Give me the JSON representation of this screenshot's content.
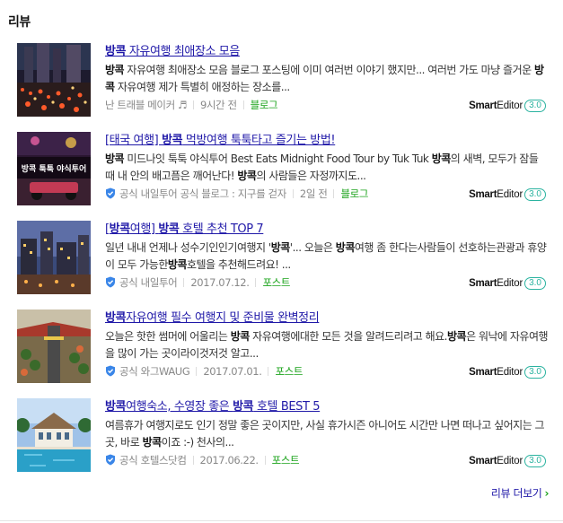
{
  "section": {
    "title": "리뷰"
  },
  "items": [
    {
      "title": [
        {
          "t": "방콕",
          "b": true
        },
        {
          "t": " 자유여행 최애장소 모음",
          "b": false
        }
      ],
      "desc": [
        {
          "t": "방콕",
          "b": true
        },
        {
          "t": " 자유여행 최애장소 모음 블로그 포스팅에 이미 여러번 이야기 했지만... 여러번 가도 마냥 즐거운 ",
          "b": false
        },
        {
          "t": "방콕",
          "b": true
        },
        {
          "t": " 자유여행 제가 특별히 애정하는 장소를...",
          "b": false
        }
      ],
      "official": false,
      "source": "난 트래블 메이커 ♬",
      "date": "9시간 전",
      "type": "블로그",
      "editor": [
        "Smart",
        "Editor",
        "3.0"
      ],
      "thumb": "city-traffic"
    },
    {
      "title": [
        {
          "t": "[태국 여행] ",
          "b": false
        },
        {
          "t": "방콕",
          "b": true
        },
        {
          "t": " 먹방여행 툭툭타고 즐기는 방법!",
          "b": false
        }
      ],
      "desc": [
        {
          "t": "방콕",
          "b": true
        },
        {
          "t": " 미드나잇 툭툭 야식투어 Best Eats Midnight Food Tour by Tuk Tuk ",
          "b": false
        },
        {
          "t": "방콕",
          "b": true
        },
        {
          "t": "의 새벽, 모두가 잠들 때 내 안의 배고픔은 깨어난다! ",
          "b": false
        },
        {
          "t": "방콕",
          "b": true
        },
        {
          "t": "의 사람들은 자정까지도...",
          "b": false
        }
      ],
      "official": true,
      "badge": "공식",
      "source": "내일투어 공식 블로그 : 지구를 걷자",
      "date": "2일 전",
      "type": "블로그",
      "editor": [
        "Smart",
        "Editor",
        "3.0"
      ],
      "thumb": "tuktuk",
      "thumb_text": "방콕 툭툭 야식투어"
    },
    {
      "title": [
        {
          "t": "[",
          "b": false
        },
        {
          "t": "방콕",
          "b": true
        },
        {
          "t": "여행] ",
          "b": false
        },
        {
          "t": "방콕",
          "b": true
        },
        {
          "t": " 호텔 추천 TOP 7",
          "b": false
        }
      ],
      "desc": [
        {
          "t": "일년 내내 언제나 성수기인인기여행지 '",
          "b": false
        },
        {
          "t": "방콕",
          "b": true
        },
        {
          "t": "'... 오늘은 ",
          "b": false
        },
        {
          "t": "방콕",
          "b": true
        },
        {
          "t": "여행 좀 한다는사람들이 선호하는관광과 휴양이 모두 가능한",
          "b": false
        },
        {
          "t": "방콕",
          "b": true
        },
        {
          "t": "호텔을 추천해드려요! ...",
          "b": false
        }
      ],
      "official": true,
      "badge": "공식",
      "source": "내일투어",
      "date": "2017.07.12.",
      "type": "포스트",
      "editor": [
        "Smart",
        "Editor",
        "3.0"
      ],
      "thumb": "hotel-night"
    },
    {
      "title": [
        {
          "t": "방콕",
          "b": true
        },
        {
          "t": "자유여행 필수 여행지 및 준비물 완벽정리",
          "b": false
        }
      ],
      "desc": [
        {
          "t": "오늘은 핫한 썸머에 어울리는 ",
          "b": false
        },
        {
          "t": "방콕",
          "b": true
        },
        {
          "t": " 자유여행에대한 모든 것을 알려드리려고 해요.",
          "b": false
        },
        {
          "t": "방콕",
          "b": true
        },
        {
          "t": "은 워낙에 자유여행을 많이 가는 곳이라이것저것 알고...",
          "b": false
        }
      ],
      "official": true,
      "badge": "공식",
      "source": "와그WAUG",
      "date": "2017.07.01.",
      "type": "포스트",
      "editor": [
        "Smart",
        "Editor",
        "3.0"
      ],
      "thumb": "market"
    },
    {
      "title": [
        {
          "t": "방콕",
          "b": true
        },
        {
          "t": "여행숙소, 수영장 좋은 ",
          "b": false
        },
        {
          "t": "방콕",
          "b": true
        },
        {
          "t": " 호텔 BEST 5",
          "b": false
        }
      ],
      "desc": [
        {
          "t": "여름휴가 여행지로도 인기 정말 좋은 곳이지만, 사실 휴가시즌 아니어도 시간만 나면 떠나고 싶어지는 그곳, 바로 ",
          "b": false
        },
        {
          "t": "방콕",
          "b": true
        },
        {
          "t": "이죠 :-) 천사의...",
          "b": false
        }
      ],
      "official": true,
      "badge": "공식",
      "source": "호텔스닷컴",
      "date": "2017.06.22.",
      "type": "포스트",
      "editor": [
        "Smart",
        "Editor",
        "3.0"
      ],
      "thumb": "pool"
    }
  ],
  "more": {
    "label": "리뷰 더보기",
    "chevron": "›"
  },
  "colors": {
    "link": "#2019a8",
    "green": "#1aa31a",
    "shield": "#3a86e8",
    "badge": "#2bb3a0"
  }
}
